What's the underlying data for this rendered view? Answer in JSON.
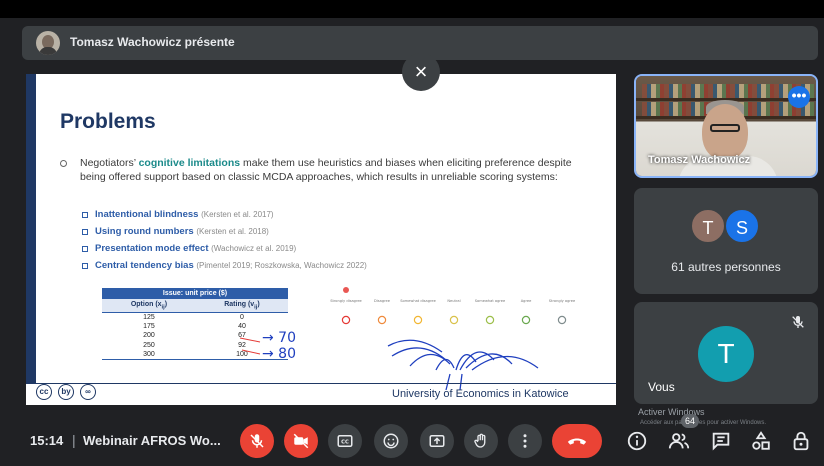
{
  "presenter_bar": {
    "label": "Tomasz Wachowicz présente"
  },
  "slide": {
    "title": "Problems",
    "bullet_pre": "Negotiators’ ",
    "bullet_keyword": "cognitive limitations",
    "bullet_post": " make them use heuristics and biases when eliciting preference despite being offered support based on classic MCDA approaches, which results in unreliable scoring systems:",
    "sub_items": [
      {
        "name": "Inattentional blindness",
        "ref": "(Kersten et al. 2017)"
      },
      {
        "name": "Using round numbers",
        "ref": "(Kersten et al. 2018)"
      },
      {
        "name": "Presentation mode effect",
        "ref": "(Wachowicz et al. 2019)"
      },
      {
        "name": "Central tendency bias",
        "ref": "(Pimentel 2019; Roszkowska, Wachowicz 2022)"
      }
    ],
    "table": {
      "header": "Issue: unit price ($)",
      "col_option": "Option (x",
      "col_option_sub": "ij",
      "col_rating": "Rating (v",
      "col_rating_sub": "ij",
      "rows": [
        [
          "125",
          "0"
        ],
        [
          "175",
          "40"
        ],
        [
          "200",
          "67"
        ],
        [
          "250",
          "92"
        ],
        [
          "300",
          "100"
        ]
      ]
    },
    "annotations": [
      "→ 70",
      "→ 80"
    ],
    "scale_labels": [
      "Strongly disagree",
      "Disagree",
      "Somewhat disagree",
      "Neutral",
      "Somewhat agree",
      "Agree",
      "Strongly agree"
    ],
    "university": "University of Economics in Katowice",
    "cc_icons": [
      "cc",
      "by",
      "∞"
    ]
  },
  "close_share": {
    "symbol": "×"
  },
  "tiles": {
    "presenter_name": "Tomasz Wachowicz",
    "more_symbol": "•••",
    "others_avatars": [
      {
        "letter": "T",
        "color": "#8d6e63"
      },
      {
        "letter": "S",
        "color": "#1a73e8"
      }
    ],
    "others_label": "61 autres personnes",
    "you_letter": "T",
    "you_label": "Vous"
  },
  "activate_windows": {
    "title": "Activer Windows",
    "subtitle": "Accéder aux paramètres pour activer Windows."
  },
  "bottom_bar": {
    "clock": "15:14",
    "separator": "|",
    "meeting_title": "Webinair AFROS Wo...",
    "people_count": "64"
  },
  "colors": {
    "background": "#202124",
    "tile": "#3c4043",
    "red": "#ea4335",
    "accent_blue": "#8ab4f8",
    "slide_navy": "#1f3864"
  },
  "icons": [
    "mic-off-icon",
    "camera-off-icon",
    "captions-icon",
    "emoji-icon",
    "present-icon",
    "raise-hand-icon",
    "more-options-icon",
    "hangup-icon",
    "info-icon",
    "people-icon",
    "chat-icon",
    "activities-icon",
    "host-controls-icon"
  ]
}
